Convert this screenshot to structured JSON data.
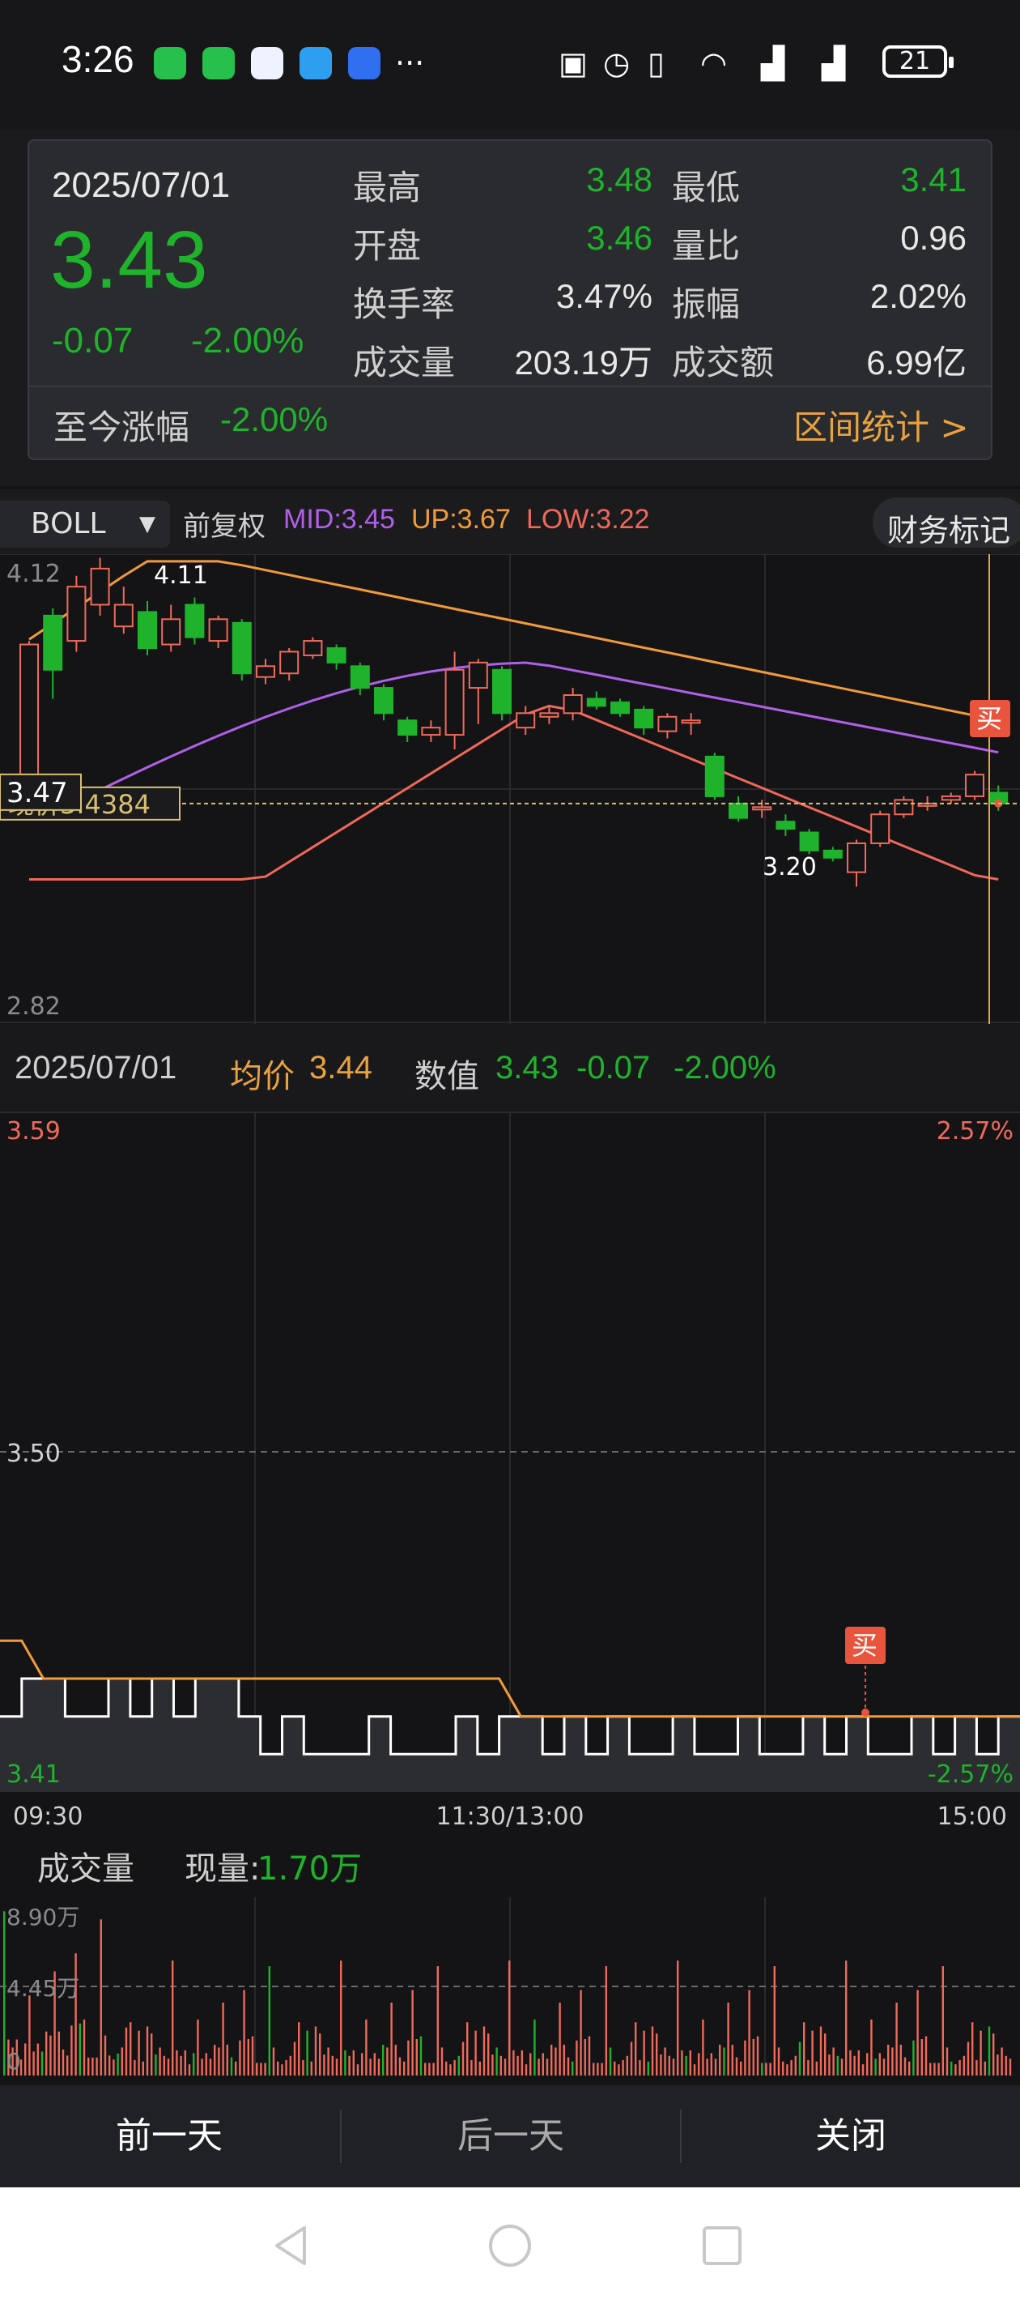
{
  "status_bar": {
    "time": "3:26",
    "more": "···",
    "battery": "21"
  },
  "popup": {
    "date": "2025/07/01",
    "price": "3.43",
    "change": "-0.07",
    "change_pct": "-2.00%",
    "rows": [
      {
        "l1": "最高",
        "v1": "3.48",
        "l2": "最低",
        "v2": "3.41"
      },
      {
        "l1": "开盘",
        "v1": "3.46",
        "l2": "量比",
        "v2": "0.96"
      },
      {
        "l1": "换手率",
        "v1": "3.47%",
        "l2": "振幅",
        "v2": "2.02%"
      },
      {
        "l1": "成交量",
        "v1": "203.19万",
        "l2": "成交额",
        "v2": "6.99亿"
      }
    ],
    "since_label": "至今涨幅",
    "since_value": "-2.00%",
    "stats_link": "区间统计 >"
  },
  "kline_header": {
    "indicator": "BOLL",
    "adjust": "前复权",
    "mid": "MID:3.45",
    "up": "UP:3.67",
    "low": "LOW:3.22",
    "finance": "财务标记"
  },
  "kline": {
    "axis_top": "4.12",
    "axis_bottom": "2.82",
    "price_tag": "3.47",
    "price_line": "现价3.4384",
    "high_label": "4.11",
    "low_label": "3.20",
    "buy": "买",
    "colors": {
      "up": "#f06a5a",
      "down": "#1fb32c",
      "upper": "#f29a3a",
      "mid": "#b060e8",
      "lower": "#f0685a"
    }
  },
  "intraday_header": {
    "date": "2025/07/01",
    "avg_label": "均价",
    "avg_value": "3.44",
    "value_label": "数值",
    "value": "3.43",
    "chg": "-0.07",
    "chg_pct": "-2.00%"
  },
  "intraday": {
    "y_top": "3.59",
    "y_mid": "3.50",
    "y_bottom": "3.41",
    "pct_top": "2.57%",
    "pct_bottom": "-2.57%",
    "times": [
      "09:30",
      "11:30/13:00",
      "15:00"
    ],
    "buy": "买"
  },
  "volume": {
    "label": "成交量",
    "now_label": "现量:",
    "now_value": "1.70万",
    "max": "8.90万",
    "mid": "4.45万",
    "zero": "0"
  },
  "bottom_buttons": {
    "prev": "前一天",
    "next": "后一天",
    "close": "关闭"
  },
  "chart_data": {
    "type": "candlestick",
    "boll": {
      "mid": 3.45,
      "up": 3.67,
      "low": 3.22
    },
    "y_range": [
      2.82,
      4.12
    ],
    "candles": [
      {
        "o": 3.5,
        "c": 3.87,
        "h": 3.88,
        "l": 3.48
      },
      {
        "o": 3.95,
        "c": 3.8,
        "h": 3.97,
        "l": 3.72
      },
      {
        "o": 3.88,
        "c": 4.03,
        "h": 4.06,
        "l": 3.85
      },
      {
        "o": 3.98,
        "c": 4.08,
        "h": 4.11,
        "l": 3.95
      },
      {
        "o": 3.92,
        "c": 3.98,
        "h": 4.03,
        "l": 3.9
      },
      {
        "o": 3.96,
        "c": 3.86,
        "h": 3.99,
        "l": 3.84
      },
      {
        "o": 3.87,
        "c": 3.94,
        "h": 3.98,
        "l": 3.85
      },
      {
        "o": 3.98,
        "c": 3.89,
        "h": 4.0,
        "l": 3.87
      },
      {
        "o": 3.88,
        "c": 3.94,
        "h": 3.95,
        "l": 3.86
      },
      {
        "o": 3.93,
        "c": 3.79,
        "h": 3.94,
        "l": 3.77
      },
      {
        "o": 3.78,
        "c": 3.81,
        "h": 3.83,
        "l": 3.76
      },
      {
        "o": 3.79,
        "c": 3.85,
        "h": 3.86,
        "l": 3.77
      },
      {
        "o": 3.84,
        "c": 3.88,
        "h": 3.89,
        "l": 3.83
      },
      {
        "o": 3.86,
        "c": 3.82,
        "h": 3.87,
        "l": 3.8
      },
      {
        "o": 3.81,
        "c": 3.75,
        "h": 3.82,
        "l": 3.73
      },
      {
        "o": 3.75,
        "c": 3.68,
        "h": 3.76,
        "l": 3.66
      },
      {
        "o": 3.66,
        "c": 3.62,
        "h": 3.67,
        "l": 3.6
      },
      {
        "o": 3.62,
        "c": 3.64,
        "h": 3.66,
        "l": 3.6
      },
      {
        "o": 3.62,
        "c": 3.8,
        "h": 3.85,
        "l": 3.58
      },
      {
        "o": 3.75,
        "c": 3.82,
        "h": 3.83,
        "l": 3.65
      },
      {
        "o": 3.8,
        "c": 3.68,
        "h": 3.81,
        "l": 3.66
      },
      {
        "o": 3.64,
        "c": 3.68,
        "h": 3.7,
        "l": 3.62
      },
      {
        "o": 3.67,
        "c": 3.68,
        "h": 3.7,
        "l": 3.65
      },
      {
        "o": 3.68,
        "c": 3.73,
        "h": 3.75,
        "l": 3.66
      },
      {
        "o": 3.72,
        "c": 3.7,
        "h": 3.74,
        "l": 3.69
      },
      {
        "o": 3.71,
        "c": 3.68,
        "h": 3.72,
        "l": 3.67
      },
      {
        "o": 3.69,
        "c": 3.64,
        "h": 3.7,
        "l": 3.62
      },
      {
        "o": 3.63,
        "c": 3.67,
        "h": 3.68,
        "l": 3.61
      },
      {
        "o": 3.66,
        "c": 3.66,
        "h": 3.68,
        "l": 3.62
      },
      {
        "o": 3.56,
        "c": 3.45,
        "h": 3.57,
        "l": 3.44
      },
      {
        "o": 3.43,
        "c": 3.39,
        "h": 3.45,
        "l": 3.38
      },
      {
        "o": 3.42,
        "c": 3.42,
        "h": 3.44,
        "l": 3.39
      },
      {
        "o": 3.38,
        "c": 3.36,
        "h": 3.4,
        "l": 3.34
      },
      {
        "o": 3.35,
        "c": 3.3,
        "h": 3.36,
        "l": 3.29
      },
      {
        "o": 3.3,
        "c": 3.28,
        "h": 3.31,
        "l": 3.27
      },
      {
        "o": 3.24,
        "c": 3.32,
        "h": 3.33,
        "l": 3.2
      },
      {
        "o": 3.32,
        "c": 3.4,
        "h": 3.41,
        "l": 3.31
      },
      {
        "o": 3.4,
        "c": 3.44,
        "h": 3.45,
        "l": 3.39
      },
      {
        "o": 3.43,
        "c": 3.43,
        "h": 3.45,
        "l": 3.41
      },
      {
        "o": 3.44,
        "c": 3.45,
        "h": 3.46,
        "l": 3.43
      },
      {
        "o": 3.45,
        "c": 3.51,
        "h": 3.52,
        "l": 3.44
      },
      {
        "o": 3.46,
        "c": 3.43,
        "h": 3.48,
        "l": 3.41
      }
    ],
    "intraday_price": [
      3.43,
      3.44,
      3.44,
      3.43,
      3.43,
      3.44,
      3.43,
      3.44,
      3.43,
      3.44,
      3.44,
      3.43,
      3.42,
      3.43,
      3.42,
      3.42,
      3.42,
      3.43,
      3.42,
      3.42,
      3.42,
      3.43,
      3.42,
      3.43,
      3.43,
      3.42,
      3.43,
      3.42,
      3.43,
      3.42,
      3.42,
      3.43,
      3.42,
      3.42,
      3.43,
      3.42,
      3.42,
      3.43,
      3.42,
      3.43,
      3.42,
      3.42,
      3.43,
      3.42,
      3.43,
      3.42,
      3.43,
      3.43
    ],
    "intraday_avg": [
      3.45,
      3.45,
      3.44,
      3.44,
      3.44,
      3.44,
      3.44,
      3.44,
      3.44,
      3.44,
      3.44,
      3.44,
      3.44,
      3.44,
      3.44,
      3.44,
      3.44,
      3.44,
      3.44,
      3.44,
      3.44,
      3.44,
      3.44,
      3.44,
      3.43,
      3.43,
      3.43,
      3.43,
      3.43,
      3.43,
      3.43,
      3.43,
      3.43,
      3.43,
      3.43,
      3.43,
      3.43,
      3.43,
      3.43,
      3.43,
      3.43,
      3.43,
      3.43,
      3.43,
      3.43,
      3.43,
      3.43,
      3.43
    ],
    "intraday_range": [
      3.41,
      3.59
    ],
    "volume_max": 8.9
  }
}
